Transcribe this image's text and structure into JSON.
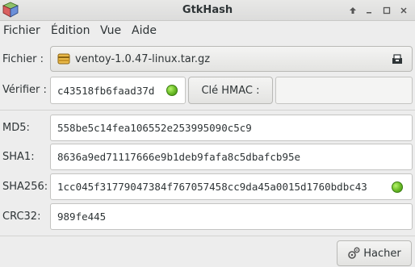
{
  "window": {
    "title": "GtkHash"
  },
  "menu": [
    "Fichier",
    "Édition",
    "Vue",
    "Aide"
  ],
  "file": {
    "label": "Fichier :",
    "name": "ventoy-1.0.47-linux.tar.gz"
  },
  "verify": {
    "label": "Vérifier :",
    "value": "c43518fb6faad37d",
    "hmac_label": "Clé HMAC :",
    "hmac_value": ""
  },
  "hashes": [
    {
      "label": "MD5:",
      "value": "558be5c14fea106552e253995090c5c9"
    },
    {
      "label": "SHA1:",
      "value": "8636a9ed71117666e9b1deb9fafa8c5dbafcb95e"
    },
    {
      "label": "SHA256:",
      "value": "1cc045f31779047384f767057458cc9da45a0015d1760bdbc43"
    },
    {
      "label": "CRC32:",
      "value": "989fe445"
    }
  ],
  "action": {
    "hash_button": "Hacher"
  },
  "colors": {
    "match_led": "#6fbf2a"
  }
}
